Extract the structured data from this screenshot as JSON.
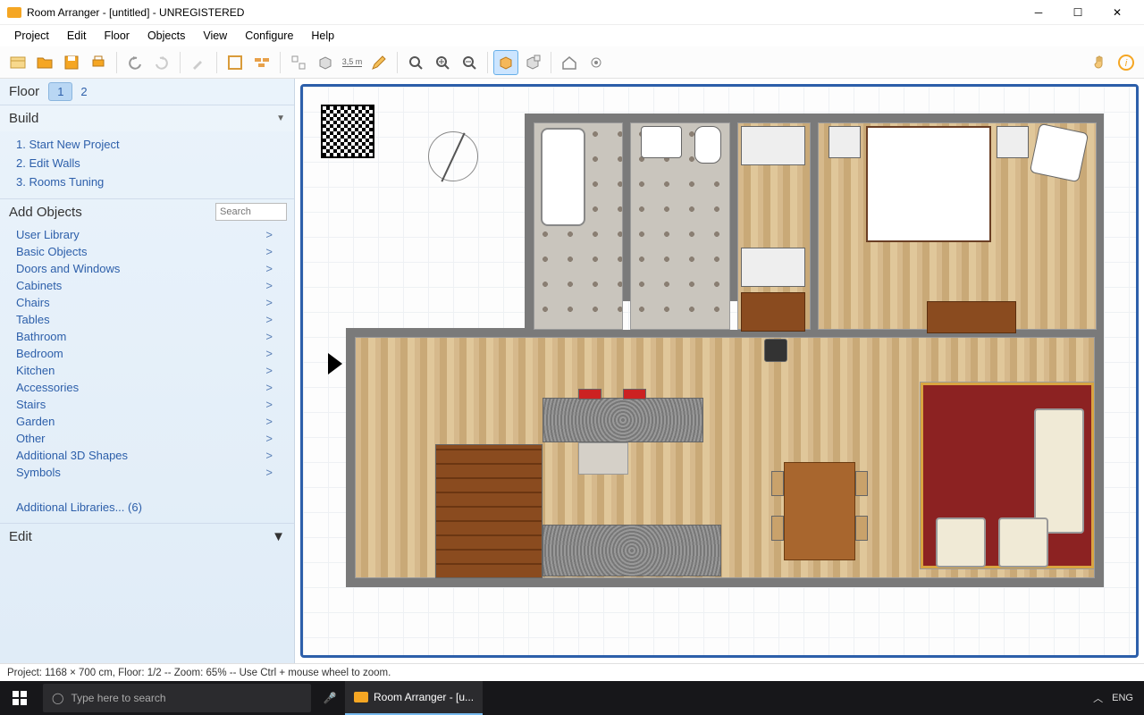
{
  "titlebar": {
    "title": "Room Arranger - [untitled] - UNREGISTERED"
  },
  "menu": {
    "items": [
      "Project",
      "Edit",
      "Floor",
      "Objects",
      "View",
      "Configure",
      "Help"
    ]
  },
  "toolbar": {
    "measure_label": "3,5 m"
  },
  "sidebar": {
    "floor_label": "Floor",
    "floors": [
      "1",
      "2"
    ],
    "active_floor": 0,
    "build": {
      "title": "Build",
      "items": [
        "1. Start New Project",
        "2. Edit Walls",
        "3. Rooms Tuning"
      ]
    },
    "add_objects": {
      "title": "Add Objects",
      "search_placeholder": "Search",
      "categories": [
        "User Library",
        "Basic Objects",
        "Doors and Windows",
        "Cabinets",
        "Chairs",
        "Tables",
        "Bathroom",
        "Bedroom",
        "Kitchen",
        "Accessories",
        "Stairs",
        "Garden",
        "Other",
        "Additional 3D Shapes",
        "Symbols"
      ],
      "additional_libraries": "Additional Libraries... (6)"
    },
    "edit": {
      "title": "Edit"
    }
  },
  "statusbar": {
    "text": "Project: 1168 × 700 cm, Floor: 1/2 -- Zoom: 65% -- Use Ctrl + mouse wheel to zoom."
  },
  "taskbar": {
    "search_placeholder": "Type here to search",
    "app_label": "Room Arranger - [u...",
    "lang": "ENG"
  }
}
